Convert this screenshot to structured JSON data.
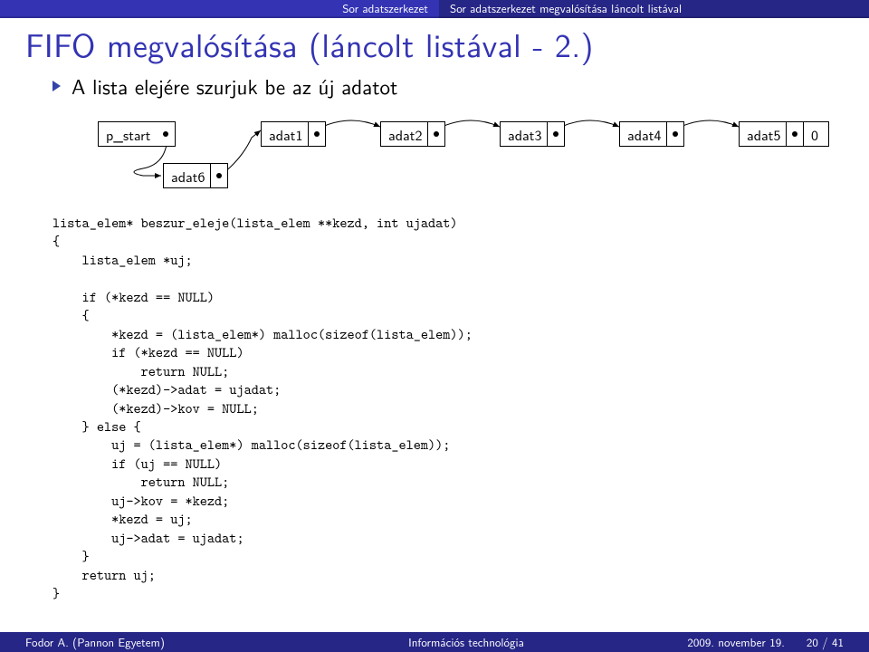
{
  "topbar": {
    "left": "Sor adatszerkezet",
    "right": "Sor adatszerkezet megvalósítása láncolt listával"
  },
  "title": "FIFO megvalósítása (láncolt listával - 2.)",
  "bullet": "A lista elejére szurjuk be az új adatot",
  "nodes": {
    "pstart": "p_start",
    "adat1": "adat1",
    "adat2": "adat2",
    "adat3": "adat3",
    "adat4": "adat4",
    "adat5": "adat5",
    "zero": "0",
    "adat6": "adat6"
  },
  "code": "lista_elem* beszur_eleje(lista_elem **kezd, int ujadat)\n{\n    lista_elem *uj;\n\n    if (*kezd == NULL)\n    {\n        *kezd = (lista_elem*) malloc(sizeof(lista_elem));\n        if (*kezd == NULL)\n            return NULL;\n        (*kezd)->adat = ujadat;\n        (*kezd)->kov = NULL;\n    } else {\n        uj = (lista_elem*) malloc(sizeof(lista_elem));\n        if (uj == NULL)\n            return NULL;\n        uj->kov = *kezd;\n        *kezd = uj;\n        uj->adat = ujadat;\n    }\n    return uj;\n}",
  "footer": {
    "author": "Fodor A. (Pannon Egyetem)",
    "title": "Információs technológia",
    "date": "2009. november 19.",
    "page": "20 / 41"
  }
}
